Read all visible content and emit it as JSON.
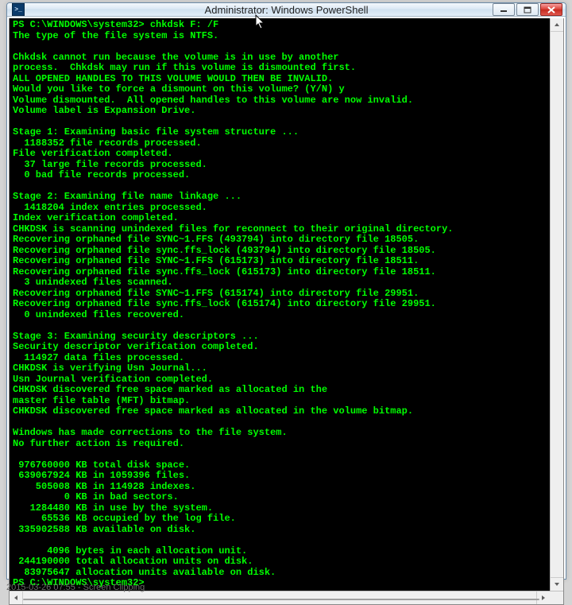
{
  "window": {
    "title": "Administrator: Windows PowerShell",
    "ps_icon_glyph": ">_"
  },
  "terminal": {
    "lines": [
      "PS C:\\WINDOWS\\system32> chkdsk F: /F",
      "The type of the file system is NTFS.",
      "",
      "Chkdsk cannot run because the volume is in use by another",
      "process.  Chkdsk may run if this volume is dismounted first.",
      "ALL OPENED HANDLES TO THIS VOLUME WOULD THEN BE INVALID.",
      "Would you like to force a dismount on this volume? (Y/N) y",
      "Volume dismounted.  All opened handles to this volume are now invalid.",
      "Volume label is Expansion Drive.",
      "",
      "Stage 1: Examining basic file system structure ...",
      "  1188352 file records processed.",
      "File verification completed.",
      "  37 large file records processed.",
      "  0 bad file records processed.",
      "",
      "Stage 2: Examining file name linkage ...",
      "  1418204 index entries processed.",
      "Index verification completed.",
      "CHKDSK is scanning unindexed files for reconnect to their original directory.",
      "Recovering orphaned file SYNC~1.FFS (493794) into directory file 18505.",
      "Recovering orphaned file sync.ffs_lock (493794) into directory file 18505.",
      "Recovering orphaned file SYNC~1.FFS (615173) into directory file 18511.",
      "Recovering orphaned file sync.ffs_lock (615173) into directory file 18511.",
      "  3 unindexed files scanned.",
      "Recovering orphaned file SYNC~1.FFS (615174) into directory file 29951.",
      "Recovering orphaned file sync.ffs_lock (615174) into directory file 29951.",
      "  0 unindexed files recovered.",
      "",
      "Stage 3: Examining security descriptors ...",
      "Security descriptor verification completed.",
      "  114927 data files processed.",
      "CHKDSK is verifying Usn Journal...",
      "Usn Journal verification completed.",
      "CHKDSK discovered free space marked as allocated in the",
      "master file table (MFT) bitmap.",
      "CHKDSK discovered free space marked as allocated in the volume bitmap.",
      "",
      "Windows has made corrections to the file system.",
      "No further action is required.",
      "",
      " 976760000 KB total disk space.",
      " 639067924 KB in 1059396 files.",
      "    505008 KB in 114928 indexes.",
      "         0 KB in bad sectors.",
      "   1284480 KB in use by the system.",
      "     65536 KB occupied by the log file.",
      " 335902588 KB available on disk.",
      "",
      "      4096 bytes in each allocation unit.",
      " 244190000 total allocation units on disk.",
      "  83975647 allocation units available on disk.",
      "PS C:\\WINDOWS\\system32>"
    ]
  },
  "caption": "2015-03-26 07:55 - Screen Clipping"
}
